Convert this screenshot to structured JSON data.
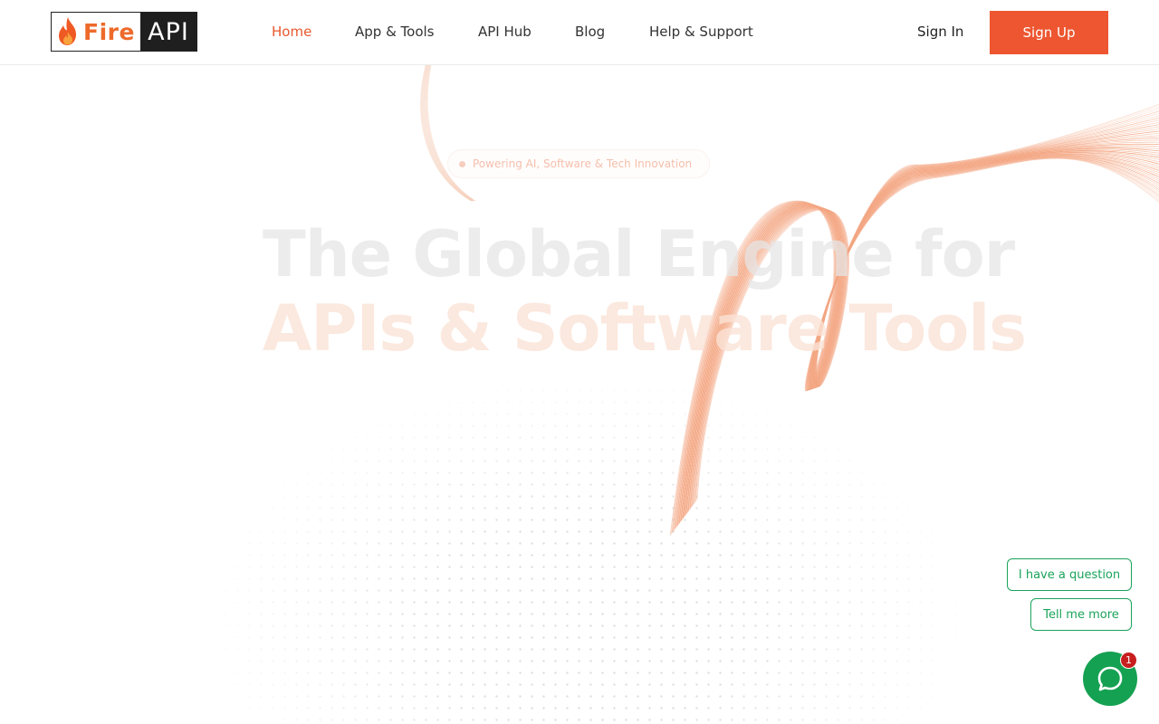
{
  "header": {
    "logo": {
      "fire_text": "Fire",
      "api_text": "API"
    },
    "nav": [
      {
        "label": "Home",
        "active": true
      },
      {
        "label": "App & Tools",
        "active": false
      },
      {
        "label": "API Hub",
        "active": false
      },
      {
        "label": "Blog",
        "active": false
      },
      {
        "label": "Help & Support",
        "active": false
      }
    ],
    "sign_in": "Sign In",
    "sign_up": "Sign Up"
  },
  "hero": {
    "badge": "Powering AI, Software & Tech Innovation",
    "headline_line1": "The Global Engine for",
    "headline_line2": "APIs & Software Tools"
  },
  "chat": {
    "quick_replies": [
      "I have a question",
      "Tell me more"
    ],
    "unread_count": "1"
  },
  "colors": {
    "accent": "#ed5630",
    "chat_green": "#15a152",
    "badge_red": "#c81e1e"
  }
}
